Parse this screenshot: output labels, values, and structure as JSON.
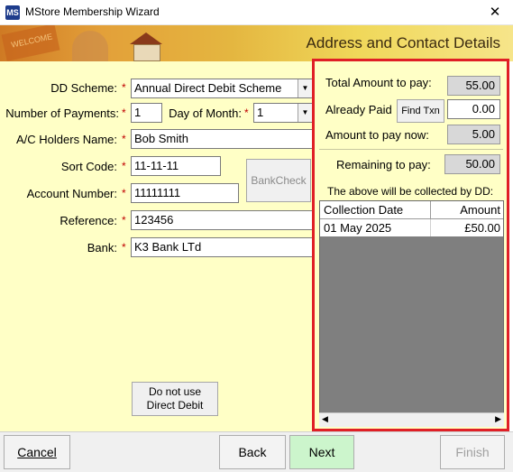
{
  "window": {
    "title": "MStore Membership Wizard",
    "app_icon": "MS",
    "close_glyph": "✕"
  },
  "banner": {
    "title": "Address and Contact Details",
    "graphic_label": "WELCOME"
  },
  "form": {
    "dd_scheme": {
      "label": "DD Scheme:",
      "value": "Annual Direct Debit Scheme"
    },
    "num_payments": {
      "label": "Number of Payments:",
      "value": "1"
    },
    "day_of_month": {
      "label": "Day of Month:",
      "value": "1"
    },
    "ac_holders_name": {
      "label": "A/C Holders Name:",
      "value": "Bob Smith"
    },
    "sort_code": {
      "label": "Sort Code:",
      "value": "11-11-11"
    },
    "account_number": {
      "label": "Account Number:",
      "value": "11111111"
    },
    "reference": {
      "label": "Reference:",
      "value": "123456"
    },
    "bank": {
      "label": "Bank:",
      "value": "K3 Bank LTd"
    },
    "required_marker": "*",
    "bankcheck_label": "BankCheck",
    "do_not_use_dd_line1": "Do not use",
    "do_not_use_dd_line2": "Direct Debit"
  },
  "summary": {
    "total_label": "Total Amount to pay:",
    "total_value": "55.00",
    "already_paid_label": "Already Paid",
    "find_txn_label": "Find Txn",
    "already_paid_value": "0.00",
    "pay_now_label": "Amount to pay now:",
    "pay_now_value": "5.00",
    "remaining_label": "Remaining to pay:",
    "remaining_value": "50.00",
    "collected_note": "The above will be collected by DD:",
    "grid": {
      "columns": [
        "Collection Date",
        "Amount"
      ],
      "rows": [
        {
          "date": "01 May 2025",
          "amount": "£50.00"
        }
      ]
    }
  },
  "buttons": {
    "cancel": "Cancel",
    "back": "Back",
    "next": "Next",
    "finish": "Finish"
  },
  "colors": {
    "panel_bg": "#ffffc6",
    "highlight_border": "#e01f26",
    "next_bg": "#ccf5cc",
    "required": "#c00000"
  }
}
